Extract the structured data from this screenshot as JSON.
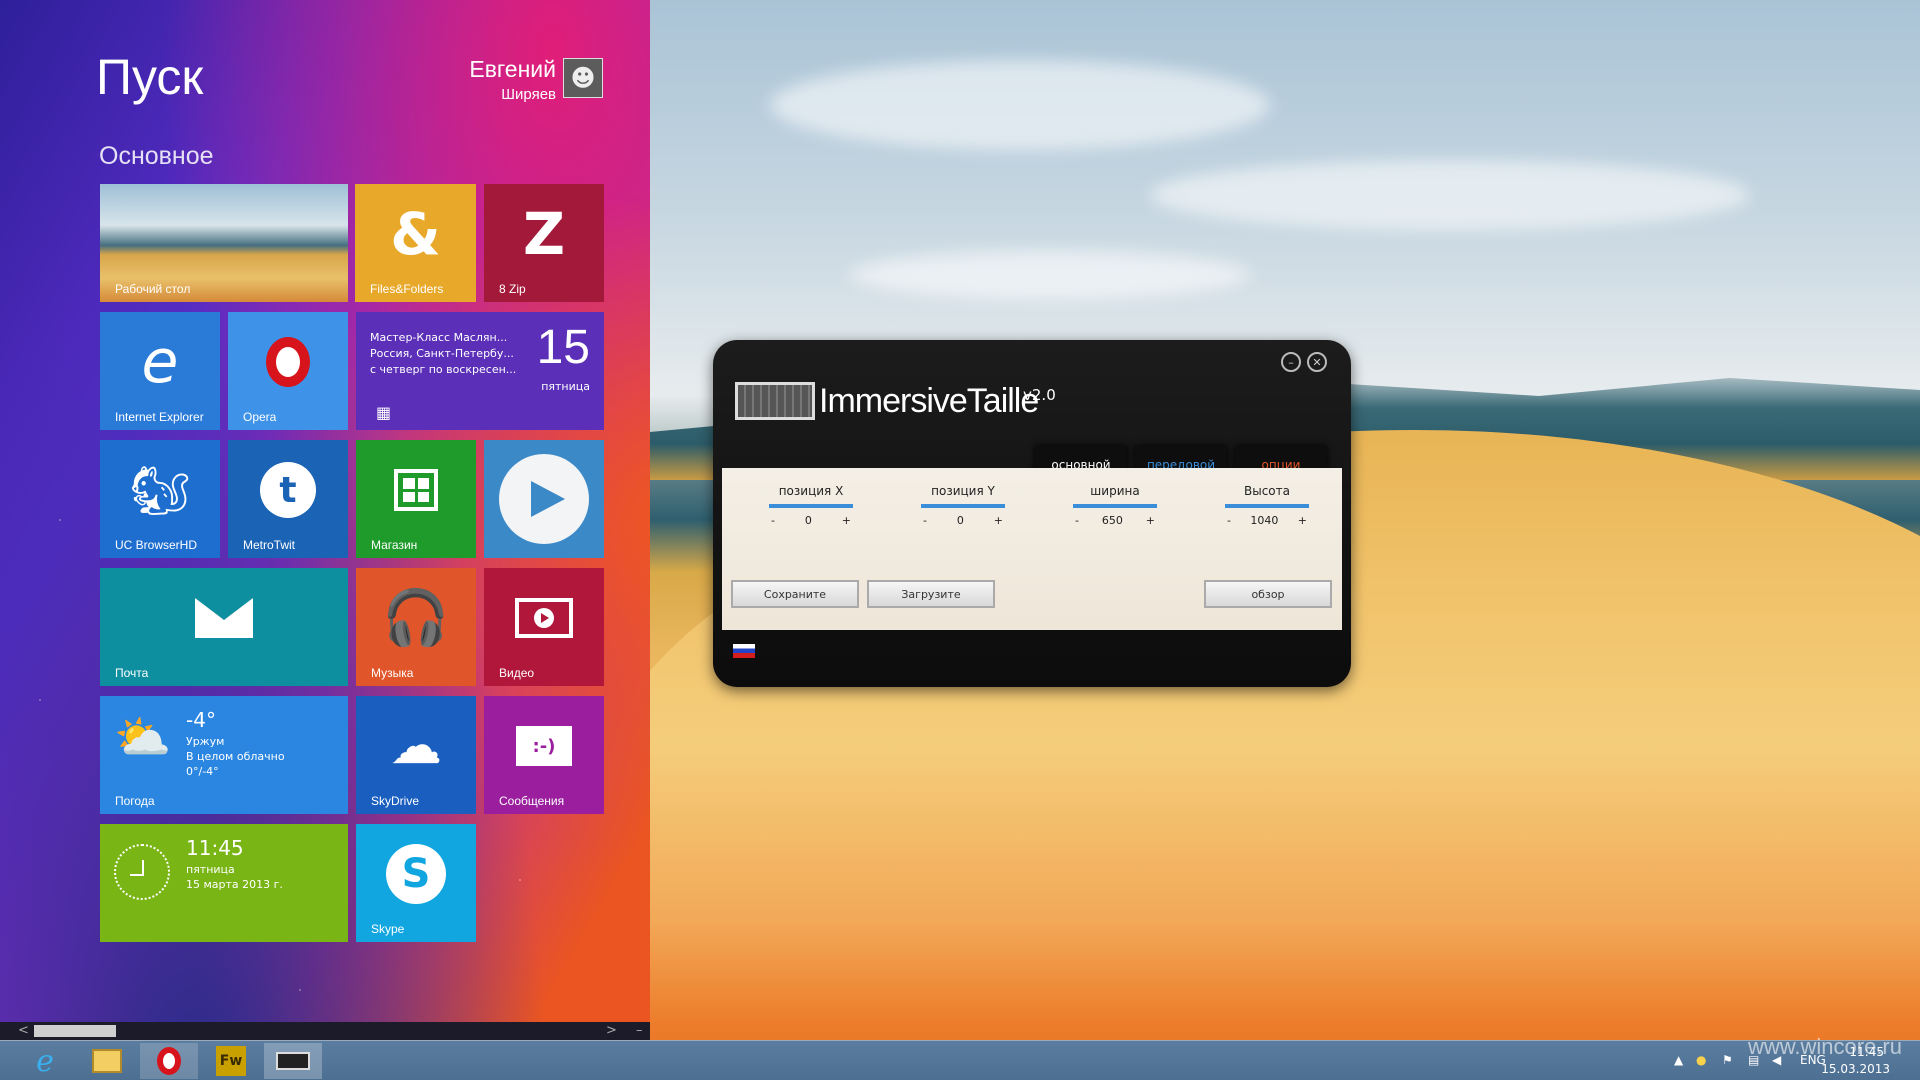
{
  "start": {
    "title": "Пуск",
    "user_first": "Евгений",
    "user_last": "Ширяев",
    "group_title": "Основное"
  },
  "tiles": {
    "desktop": "Рабочий стол",
    "files": "Files&Folders",
    "zip": "8 Zip",
    "ie": "Internet Explorer",
    "opera": "Opera",
    "calendar_line1": "Мастер-Класс  Маслян...",
    "calendar_line2": "Россия, Санкт-Петербу...",
    "calendar_line3": "с четверг по воскресен...",
    "calendar_day": "15",
    "calendar_weekday": "пятница",
    "uc": "UC BrowserHD",
    "metrotwit": "MetroTwit",
    "store": "Магазин",
    "mail": "Почта",
    "music": "Музыка",
    "video": "Видео",
    "weather_temp": "-4°",
    "weather_city": "Уржум",
    "weather_desc": "В целом облачно",
    "weather_range": "0°/-4°",
    "weather": "Погода",
    "skydrive": "SkyDrive",
    "messages": "Сообщения",
    "clock_time": "11:45",
    "clock_weekday": "пятница",
    "clock_date": "15 марта 2013 г.",
    "skype": "Skype"
  },
  "tile_colors": {
    "files": "#e8a92a",
    "zip": "#a3193a",
    "ie": "#2a7ad8",
    "opera": "#3e92e8",
    "calendar": "#5b2fb8",
    "uc": "#1e6ed0",
    "metrotwit": "#1a63b5",
    "store": "#1e9b2a",
    "app_play": "#3c89c8",
    "mail": "#0e8fa0",
    "music": "#e0552a",
    "video": "#b1173a",
    "weather": "#2a86e0",
    "skydrive": "#1a5fc0",
    "messages": "#9a1e9e",
    "clock": "#7ab516",
    "skype": "#12a6e0"
  },
  "dialog": {
    "title": "ImmersiveTaille",
    "version": "v2.0",
    "tabs": [
      "основной",
      "передовой",
      "опции"
    ],
    "fields": [
      {
        "label": "позиция X",
        "value": "0"
      },
      {
        "label": "позиция Y",
        "value": "0"
      },
      {
        "label": "ширина",
        "value": "650"
      },
      {
        "label": "Высота",
        "value": "1040"
      }
    ],
    "minus": "-",
    "plus": "+",
    "save": "Сохраните",
    "load": "Загрузите",
    "browse": "обзор"
  },
  "taskbar": {
    "lang": "ENG",
    "time": "11:45",
    "date": "15.03.2013",
    "fw_label": "Fw"
  },
  "watermark": "www.wincore.ru"
}
